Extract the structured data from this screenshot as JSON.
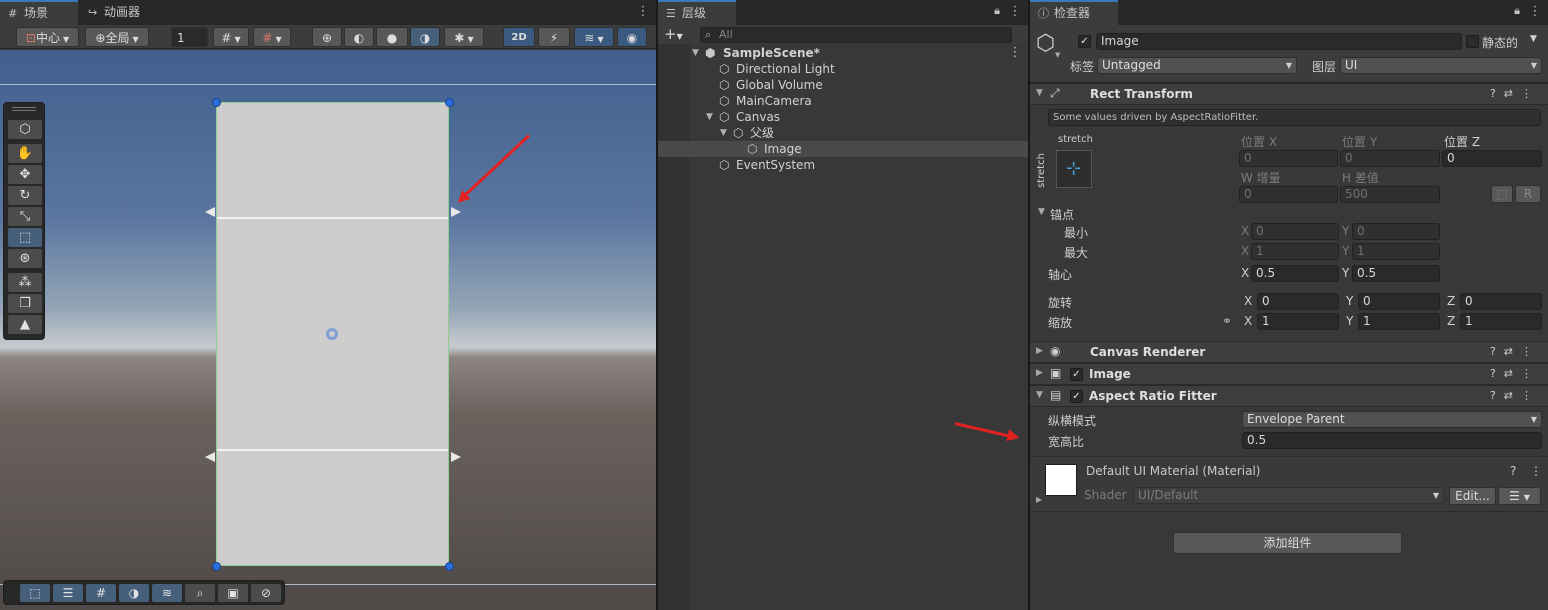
{
  "scene": {
    "tabs": [
      {
        "label": "场景",
        "icon": "grid-icon"
      },
      {
        "label": "动画器",
        "icon": "animator-icon"
      }
    ],
    "toolbar": {
      "pivot_mode": "中心",
      "handle_space": "全局",
      "grid_step": "1",
      "mode_2d": "2D"
    }
  },
  "hierarchy": {
    "tab": "层级",
    "search_placeholder": "All",
    "items": [
      {
        "label": "SampleScene*",
        "level": 0,
        "icon": "unity-scene-icon",
        "bold": true
      },
      {
        "label": "Directional Light",
        "level": 1,
        "icon": "gameobject-icon"
      },
      {
        "label": "Global Volume",
        "level": 1,
        "icon": "gameobject-icon"
      },
      {
        "label": "MainCamera",
        "level": 1,
        "icon": "gameobject-icon"
      },
      {
        "label": "Canvas",
        "level": 1,
        "icon": "gameobject-icon"
      },
      {
        "label": "父级",
        "level": 2,
        "icon": "gameobject-icon"
      },
      {
        "label": "Image",
        "level": 3,
        "icon": "gameobject-icon",
        "selected": true
      },
      {
        "label": "EventSystem",
        "level": 1,
        "icon": "gameobject-icon"
      }
    ]
  },
  "inspector": {
    "tab": "检查器",
    "object_name": "Image",
    "static_label": "静态的",
    "tag_label": "标签",
    "tag_value": "Untagged",
    "layer_label": "图层",
    "layer_value": "UI",
    "rect_transform": {
      "title": "Rect Transform",
      "driven_note": "Some values driven by AspectRatioFitter.",
      "anchor_preset_h": "stretch",
      "anchor_preset_v": "stretch",
      "pos_x_label": "位置 X",
      "pos_y_label": "位置 Y",
      "pos_z_label": "位置 Z",
      "pos_x": "0",
      "pos_y": "0",
      "pos_z": "0",
      "w_label": "W 增量",
      "h_label": "H 差值",
      "w": "0",
      "h": "500",
      "raw_button": "R",
      "anchors_label": "锚点",
      "min_label": "最小",
      "max_label": "最大",
      "min_x": "0",
      "min_y": "0",
      "max_x": "1",
      "max_y": "1",
      "pivot_label": "轴心",
      "pivot_x": "0.5",
      "pivot_y": "0.5",
      "rotation_label": "旋转",
      "rot_x": "0",
      "rot_y": "0",
      "rot_z": "0",
      "scale_label": "缩放",
      "scale_x": "1",
      "scale_y": "1",
      "scale_z": "1",
      "axis_x": "X",
      "axis_y": "Y",
      "axis_z": "Z"
    },
    "canvas_renderer": {
      "title": "Canvas Renderer"
    },
    "image": {
      "title": "Image"
    },
    "aspect_ratio_fitter": {
      "title": "Aspect Ratio Fitter",
      "mode_label": "纵横模式",
      "mode_value": "Envelope Parent",
      "ratio_label": "宽高比",
      "ratio_value": "0.5"
    },
    "material": {
      "name": "Default UI Material (Material)",
      "shader_label": "Shader",
      "shader_value": "UI/Default",
      "edit_button": "Edit..."
    },
    "add_component": "添加组件"
  },
  "colors": {
    "accent": "#3a79bb",
    "selected_tool": "#46607c",
    "annotation_arrow": "#e42121"
  }
}
